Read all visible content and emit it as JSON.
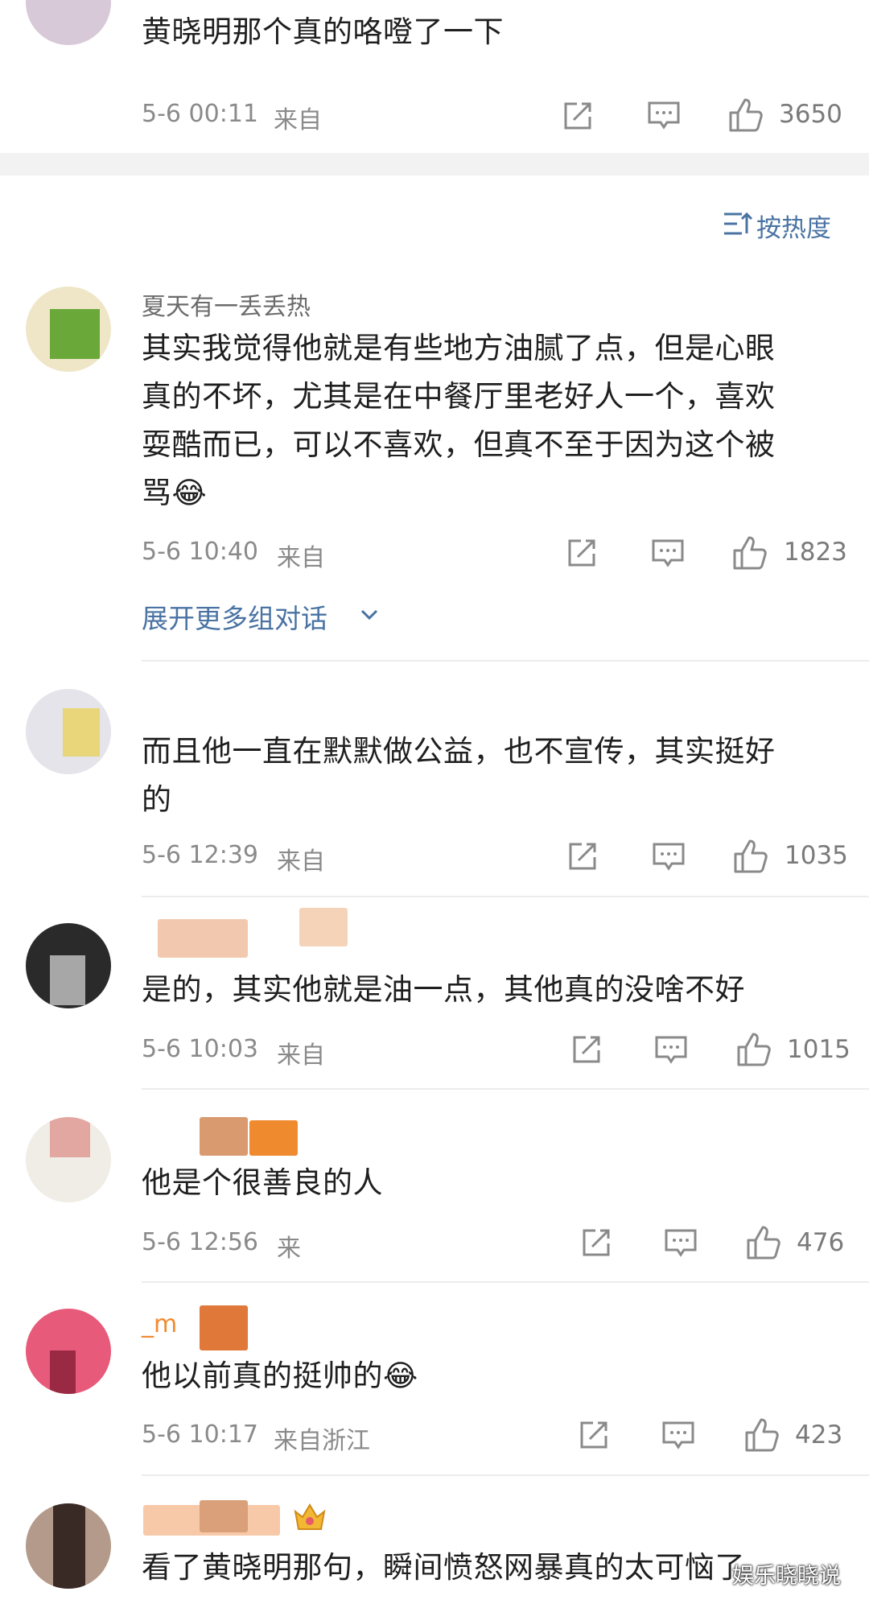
{
  "top_comment": {
    "text": "黄晓明那个真的咯噔了一下",
    "time": "5-6 00:11",
    "source": "来自",
    "likes": "3650"
  },
  "sort_label": "按热度",
  "comments": [
    {
      "name": "夏天有一丢丢热",
      "text": [
        "其实我觉得他就是有些地方油腻了点，但是心眼",
        "真的不坏，尤其是在中餐厅里老好人一个，喜欢",
        "耍酷而已，可以不喜欢，但真不至于因为这个被",
        "骂😂"
      ],
      "time": "5-6 10:40",
      "source": "来自",
      "likes": "1823",
      "expand": "展开更多组对话"
    },
    {
      "text": [
        "而且他一直在默默做公益，也不宣传，其实挺好",
        "的"
      ],
      "time": "5-6 12:39",
      "source": "来自",
      "likes": "1035"
    },
    {
      "text": [
        "是的，其实他就是油一点，其他真的没啥不好"
      ],
      "time": "5-6 10:03",
      "source": "来自",
      "likes": "1015"
    },
    {
      "text": [
        "他是个很善良的人"
      ],
      "time": "5-6 12:56",
      "source": "来",
      "likes": "476"
    },
    {
      "name": "_m",
      "text": [
        "他以前真的挺帅的😂"
      ],
      "time": "5-6 10:17",
      "source": "来自浙江",
      "likes": "423"
    },
    {
      "text": [
        "看了黄晓明那句，瞬间愤怒网暴真的太可恼了"
      ]
    }
  ],
  "watermark": "娱乐晓晓说",
  "colors": {
    "link": "#4a73a3",
    "meta": "#8a8a8a",
    "divider": "#ececec",
    "separator": "#f2f2f2"
  }
}
